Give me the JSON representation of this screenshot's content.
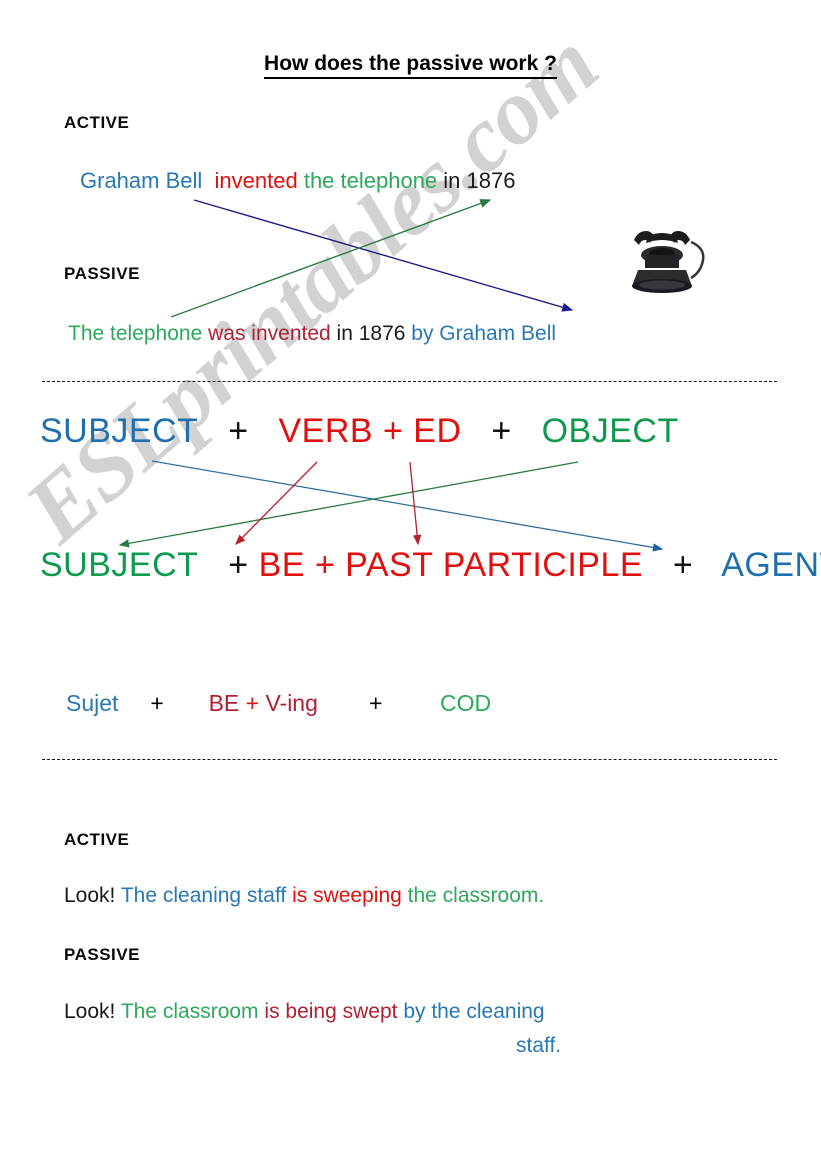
{
  "page": {
    "title": "How does the passive work ?",
    "watermark": "ESLprintables.com"
  },
  "colors": {
    "blue": "#2878b4",
    "blue_dark": "#1f6faf",
    "green": "#2ea85c",
    "green_dark": "#0e9a4e",
    "red": "#e01010",
    "red_dark": "#b02035",
    "black": "#1a1a1a",
    "watermark_gray": "#d2d2d2"
  },
  "section1": {
    "active_label": "ACTIVE",
    "active_sentence": {
      "subject": "Graham Bell",
      "verb": "invented",
      "object": "the telephone",
      "time": "in 1876"
    },
    "passive_label": "PASSIVE",
    "passive_sentence": {
      "subject": "The telephone",
      "verb": "was invented",
      "time": "in 1876",
      "agent": "by Graham Bell"
    },
    "illustration": "rotary-telephone"
  },
  "section2": {
    "active_formula": {
      "subject": "SUBJECT",
      "plus1": "+",
      "verb": "VERB + ED",
      "plus2": "+",
      "object": "OBJECT"
    },
    "passive_formula": {
      "subject": "SUBJECT",
      "plus1": "+",
      "verb": "BE + PAST PARTICIPLE",
      "plus2": "+",
      "agent": "AGENT"
    },
    "french_formula": {
      "subject": "Sujet",
      "plus1": "+",
      "be": "BE",
      "plus_mid": "+",
      "ving": "V-ing",
      "plus2": "+",
      "cod": "COD"
    }
  },
  "section3": {
    "active_label": "ACTIVE",
    "active_sentence": {
      "intro": "Look!",
      "subject": "The cleaning staff",
      "verb": "is sweeping",
      "object": "the classroom."
    },
    "passive_label": "PASSIVE",
    "passive_sentence": {
      "intro": "Look!",
      "subject": "The classroom",
      "verb": "is being swept",
      "agent_line1": "by the cleaning",
      "agent_line2": "staff."
    }
  }
}
